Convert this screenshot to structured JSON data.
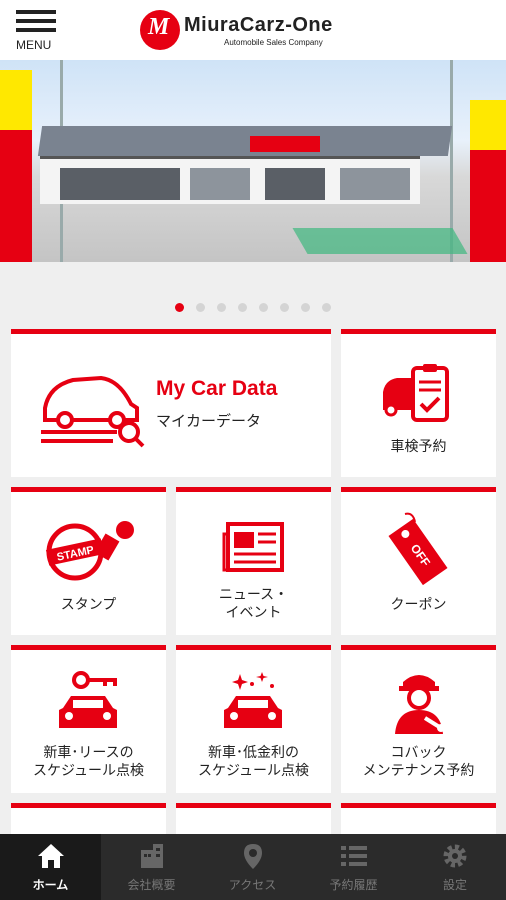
{
  "header": {
    "menu_label": "MENU",
    "brand_name": "MiuraCarz-One",
    "brand_tagline": "Automobile Sales Company"
  },
  "banner": {
    "slide_count": 8,
    "active_index": 0
  },
  "tiles": {
    "my_car_data": {
      "title_en": "My Car Data",
      "title_ja": "マイカーデータ"
    },
    "shaken_reservation": {
      "label": "車検予約"
    },
    "stamp": {
      "label": "スタンプ"
    },
    "news_events": {
      "label_line1": "ニュース・",
      "label_line2": "イベント"
    },
    "coupon": {
      "label": "クーポン"
    },
    "new_car_lease": {
      "label_line1": "新車･リースの",
      "label_line2": "スケジュール点検"
    },
    "new_car_low_rate": {
      "label_line1": "新車･低金利の",
      "label_line2": "スケジュール点検"
    },
    "kobakku": {
      "label_line1": "コバック",
      "label_line2": "メンテナンス予約"
    }
  },
  "footer": {
    "items": [
      {
        "label": "ホーム",
        "icon": "home-icon",
        "active": true
      },
      {
        "label": "会社概要",
        "icon": "building-icon",
        "active": false
      },
      {
        "label": "アクセス",
        "icon": "map-pin-icon",
        "active": false
      },
      {
        "label": "予約履歴",
        "icon": "list-icon",
        "active": false
      },
      {
        "label": "設定",
        "icon": "gear-icon",
        "active": false
      }
    ]
  },
  "colors": {
    "accent": "#e60012",
    "background": "#efefef",
    "footer": "#2b2b2b"
  }
}
